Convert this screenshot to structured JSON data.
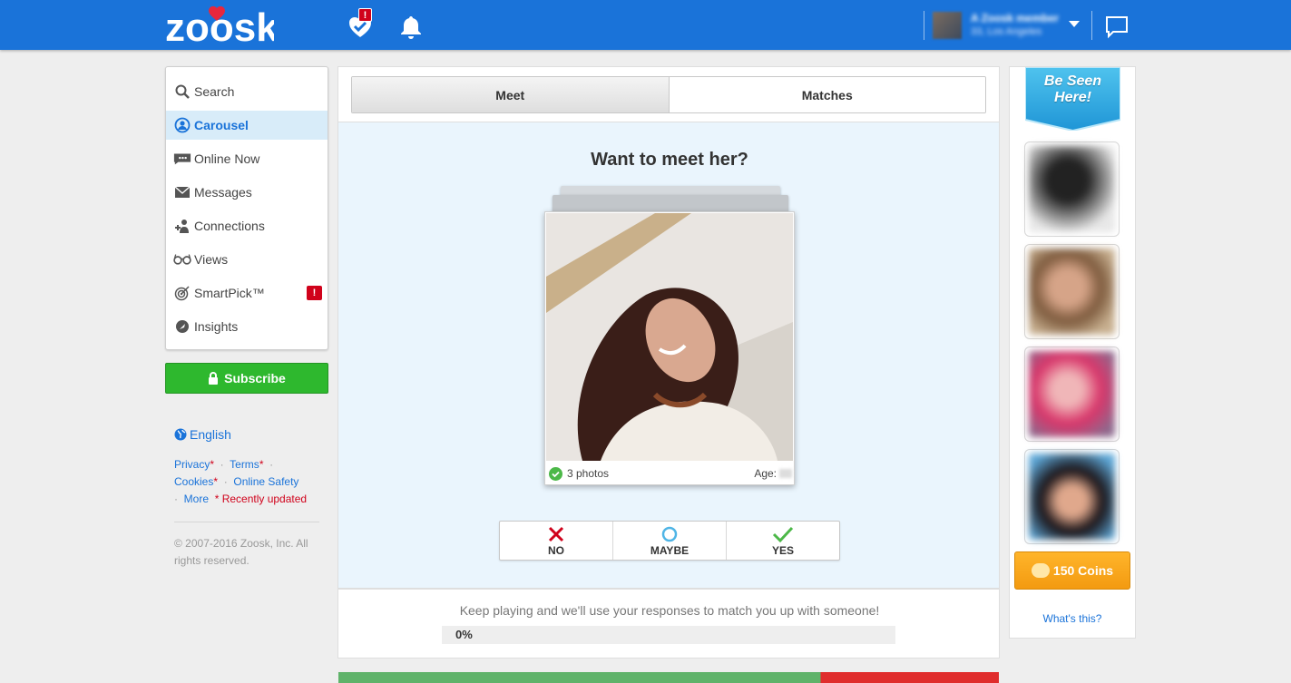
{
  "header": {
    "logo_text": "zoosk",
    "smartpick_badge": "!",
    "user_name": "A Zoosk member",
    "user_location": "33, Los Angeles"
  },
  "sidebar": {
    "items": [
      {
        "label": "Search",
        "icon": "search-icon"
      },
      {
        "label": "Carousel",
        "icon": "carousel-icon",
        "active": true
      },
      {
        "label": "Online Now",
        "icon": "chat-bubble-icon"
      },
      {
        "label": "Messages",
        "icon": "envelope-icon"
      },
      {
        "label": "Connections",
        "icon": "connections-icon"
      },
      {
        "label": "Views",
        "icon": "glasses-icon"
      },
      {
        "label": "SmartPick™",
        "icon": "target-icon",
        "badge": "!"
      },
      {
        "label": "Insights",
        "icon": "insights-icon"
      }
    ],
    "subscribe_label": "Subscribe",
    "language": "English",
    "links": {
      "privacy": "Privacy",
      "terms": "Terms",
      "cookies": "Cookies",
      "online_safety": "Online Safety",
      "more": "More",
      "star": "*",
      "recently_updated": "* Recently updated"
    },
    "copyright": "© 2007-2016 Zoosk, Inc. All rights reserved."
  },
  "main": {
    "tabs": [
      {
        "label": "Meet",
        "active": true
      },
      {
        "label": "Matches"
      }
    ],
    "question": "Want to meet her?",
    "card": {
      "photos": "3 photos",
      "age_label": "Age:"
    },
    "vote": {
      "no": "NO",
      "maybe": "MAYBE",
      "yes": "YES"
    },
    "progress": {
      "text": "Keep playing and we'll use your responses to match you up with someone!",
      "label": "0%",
      "value": 0
    }
  },
  "rightcol": {
    "be_seen": "Be Seen Here!",
    "coins_label": "150 Coins",
    "whats_this": "What's this?"
  },
  "colors": {
    "brand_blue": "#1a73d9",
    "subscribe_green": "#2eb82e",
    "coins_orange": "#f7a21b",
    "alert_red": "#d0021b"
  }
}
